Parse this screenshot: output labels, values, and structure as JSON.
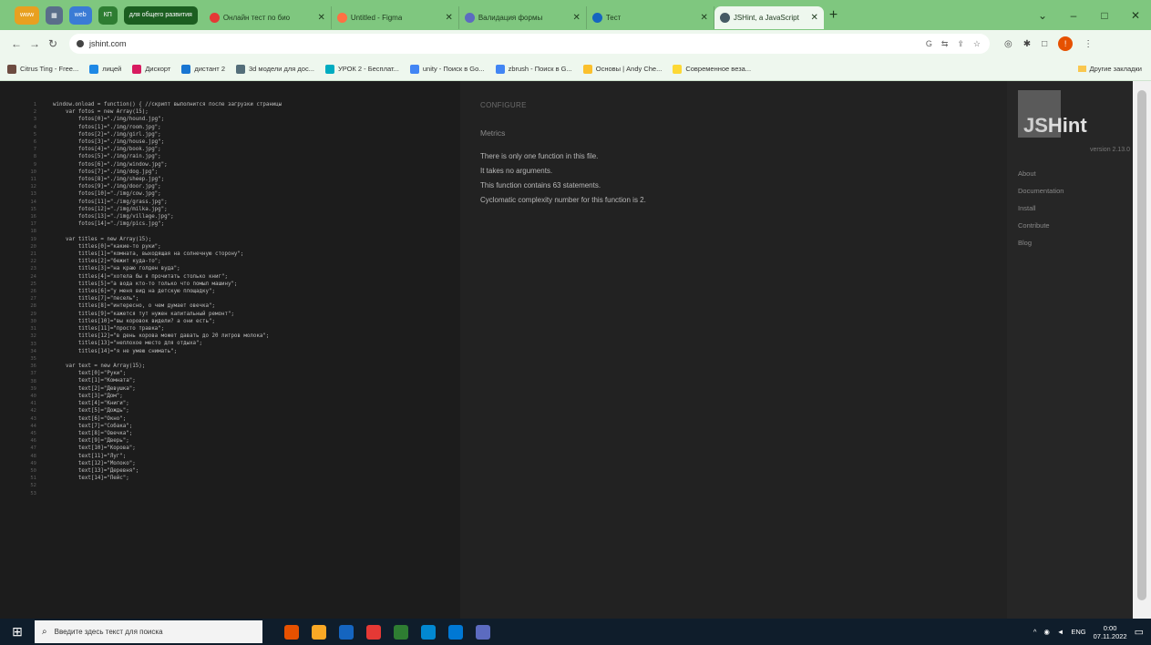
{
  "browser": {
    "tab_groups": [
      {
        "label": "www",
        "color": "#e8a020"
      },
      {
        "label": "▦",
        "color": "#5a6e8a"
      },
      {
        "label": "web",
        "color": "#3a7bd5"
      },
      {
        "label": "КП",
        "color": "#2e7d32"
      },
      {
        "label": "для общего развития",
        "color": "#1b5e20"
      }
    ],
    "tabs": [
      {
        "title": "Онлайн тест по био",
        "color": "#e53935",
        "active": false
      },
      {
        "title": "Untitled - Figma",
        "color": "#ff7043",
        "active": false
      },
      {
        "title": "Валидация формы",
        "color": "#5c6bc0",
        "active": false
      },
      {
        "title": "Тест",
        "color": "#1565c0",
        "active": false
      },
      {
        "title": "JSHint, a JavaScript",
        "color": "#455a64",
        "active": true
      }
    ],
    "new_tab": "+",
    "window_controls": [
      "⌄",
      "–",
      "□",
      "✕"
    ],
    "url": "jshint.com",
    "profile_initial": "!",
    "bookmarks": [
      {
        "label": "Citrus Ting - Free...",
        "color": "#6d4c41"
      },
      {
        "label": "лицей",
        "color": "#1e88e5"
      },
      {
        "label": "Дискорт",
        "color": "#d81b60"
      },
      {
        "label": "дистант 2",
        "color": "#1976d2"
      },
      {
        "label": "3d модели для дос...",
        "color": "#546e7a"
      },
      {
        "label": "УРОК 2 - Бесплат...",
        "color": "#00acc1"
      },
      {
        "label": "unity - Поиск в Go...",
        "color": "#4285f4"
      },
      {
        "label": "zbrush - Поиск в G...",
        "color": "#4285f4"
      },
      {
        "label": "Основы | Andy Che...",
        "color": "#fbc02d"
      },
      {
        "label": "Современное веза...",
        "color": "#fdd835"
      }
    ],
    "other_bookmarks": "Другие закладки"
  },
  "editor": {
    "line_count": 53,
    "code_lines": [
      "window.onload = function() { //скрипт выполнится после загрузки страницы",
      "    var fotos = new Array(15);",
      "        fotos[0]=\"./img/hound.jpg\";",
      "        fotos[1]=\"./img/room.jpg\";",
      "        fotos[2]=\"./img/girl.jpg\";",
      "        fotos[3]=\"./img/house.jpg\";",
      "        fotos[4]=\"./img/book.jpg\";",
      "        fotos[5]=\"./img/rain.jpg\";",
      "        fotos[6]=\"./img/window.jpg\";",
      "        fotos[7]=\"./img/dog.jpg\";",
      "        fotos[8]=\"./img/sheep.jpg\";",
      "        fotos[9]=\"./img/door.jpg\";",
      "        fotos[10]=\"./img/cow.jpg\";",
      "        fotos[11]=\"./img/grass.jpg\";",
      "        fotos[12]=\"./img/milka.jpg\";",
      "        fotos[13]=\"./img/village.jpg\";",
      "        fotos[14]=\"./img/pics.jpg\";",
      "",
      "    var titles = new Array(15);",
      "        titles[0]=\"какие-то руки\";",
      "        titles[1]=\"комната, выходящая на солнечную сторону\";",
      "        titles[2]=\"бежит куда-то\";",
      "        titles[3]=\"на краю голден вуда\";",
      "        titles[4]=\"хотела бы я прочитать столько книг\";",
      "        titles[5]=\"а вода кто-то только что помыл машину\";",
      "        titles[6]=\"у меня вид на детскую площадку\";",
      "        titles[7]=\"песель\";",
      "        titles[8]=\"интересно, о чем думает овечка\";",
      "        titles[9]=\"кажется тут нужен капитальный ремонт\";",
      "        titles[10]=\"вы коровок видели? а они есть\";",
      "        titles[11]=\"просто травка\";",
      "        titles[12]=\"в день корова может давать до 20 литров молока\";",
      "        titles[13]=\"неплохое место для отдыха\";",
      "        titles[14]=\"я не умею снимать\";",
      "",
      "    var text = new Array(15);",
      "        text[0]=\"Руки\";",
      "        text[1]=\"Комната\";",
      "        text[2]=\"Девушка\";",
      "        text[3]=\"Дом\";",
      "        text[4]=\"Книги\";",
      "        text[5]=\"Дождь\";",
      "        text[6]=\"Окно\";",
      "        text[7]=\"Собака\";",
      "        text[8]=\"Овечка\";",
      "        text[9]=\"Дверь\";",
      "        text[10]=\"Корова\";",
      "        text[11]=\"Луг\";",
      "        text[12]=\"Молоко\";",
      "        text[13]=\"Деревня\";",
      "        text[14]=\"Пейс\";",
      "",
      ""
    ]
  },
  "results": {
    "configure_label": "CONFIGURE",
    "metrics_heading": "Metrics",
    "metrics": [
      "There is only one function in this file.",
      "It takes no arguments.",
      "This function contains 63 statements.",
      "Cyclomatic complexity number for this function is 2."
    ]
  },
  "sidebar": {
    "logo_js": "JS",
    "logo_hint": "Hint",
    "version": "version 2.13.0",
    "links": [
      "About",
      "Documentation",
      "Install",
      "Contribute",
      "Blog"
    ]
  },
  "taskbar": {
    "search_placeholder": "Введите здесь текст для поиска",
    "lang": "ENG",
    "time": "0:00",
    "date": "07.11.2022",
    "app_colors": [
      "#e65100",
      "#f9a825",
      "#1565c0",
      "#e53935",
      "#2e7d32",
      "#0288d1",
      "#0078d4",
      "#5c6bc0"
    ]
  }
}
